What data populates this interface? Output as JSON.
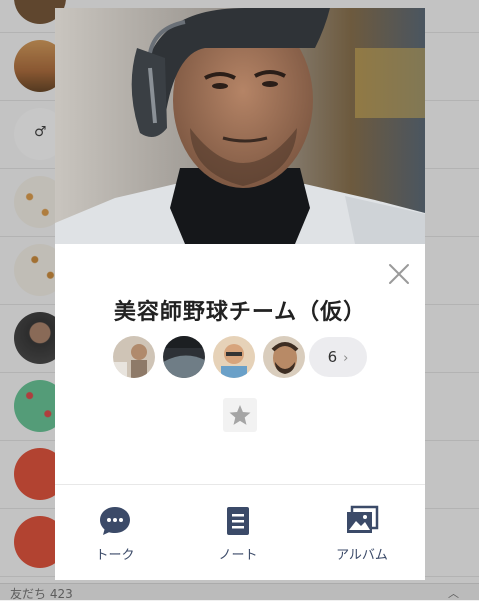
{
  "background": {
    "friends_count_label": "友だち 423"
  },
  "group": {
    "name": "美容師野球チーム（仮）",
    "more_members_count": "6"
  },
  "actions": {
    "talk_label": "トーク",
    "note_label": "ノート",
    "album_label": "アルバム"
  },
  "colors": {
    "action_icon": "#3b4a68",
    "overlay": "rgba(0,0,0,0.22)"
  }
}
